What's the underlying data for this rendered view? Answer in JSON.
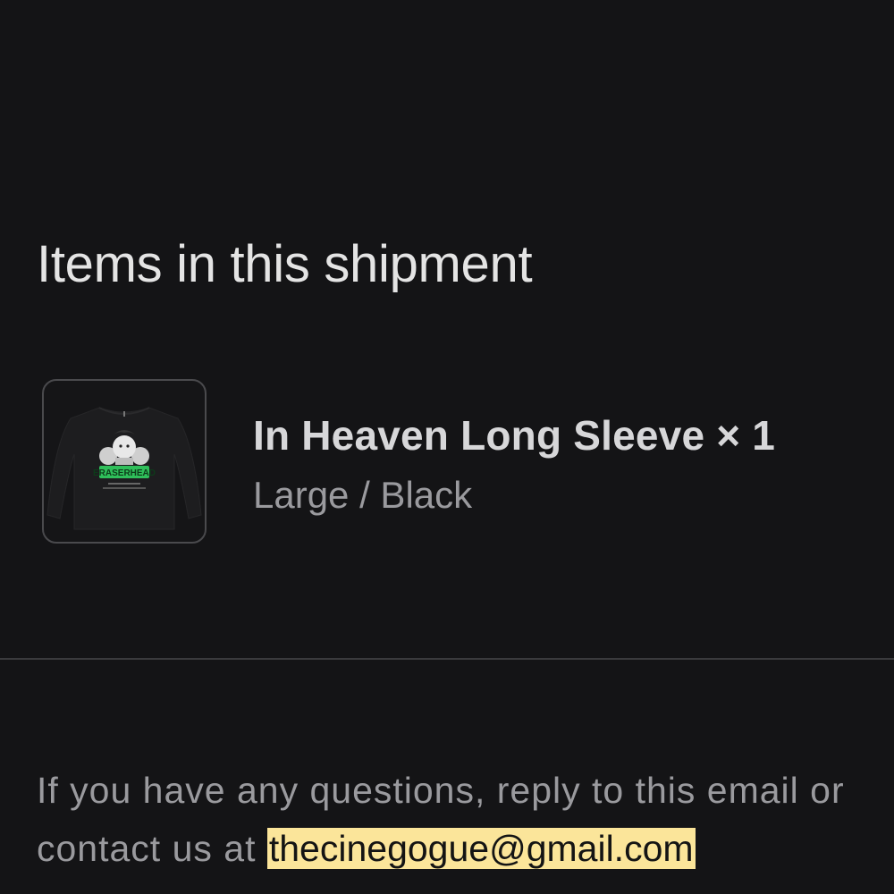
{
  "shipment": {
    "section_title": "Items in this shipment",
    "items": [
      {
        "title": "In Heaven Long Sleeve × 1",
        "variant": "Large / Black",
        "thumbnail_icon": "long-sleeve-shirt-product-image",
        "thumbnail_text": "ERASERHEAD"
      }
    ]
  },
  "footer": {
    "text_before": "If you have any questions, reply to this email or contact us at ",
    "email": "thecinegogue@gmail.com"
  },
  "colors": {
    "background": "#141416",
    "highlight": "#fbe59a",
    "thumbnail_accent": "#2fbf5a"
  }
}
